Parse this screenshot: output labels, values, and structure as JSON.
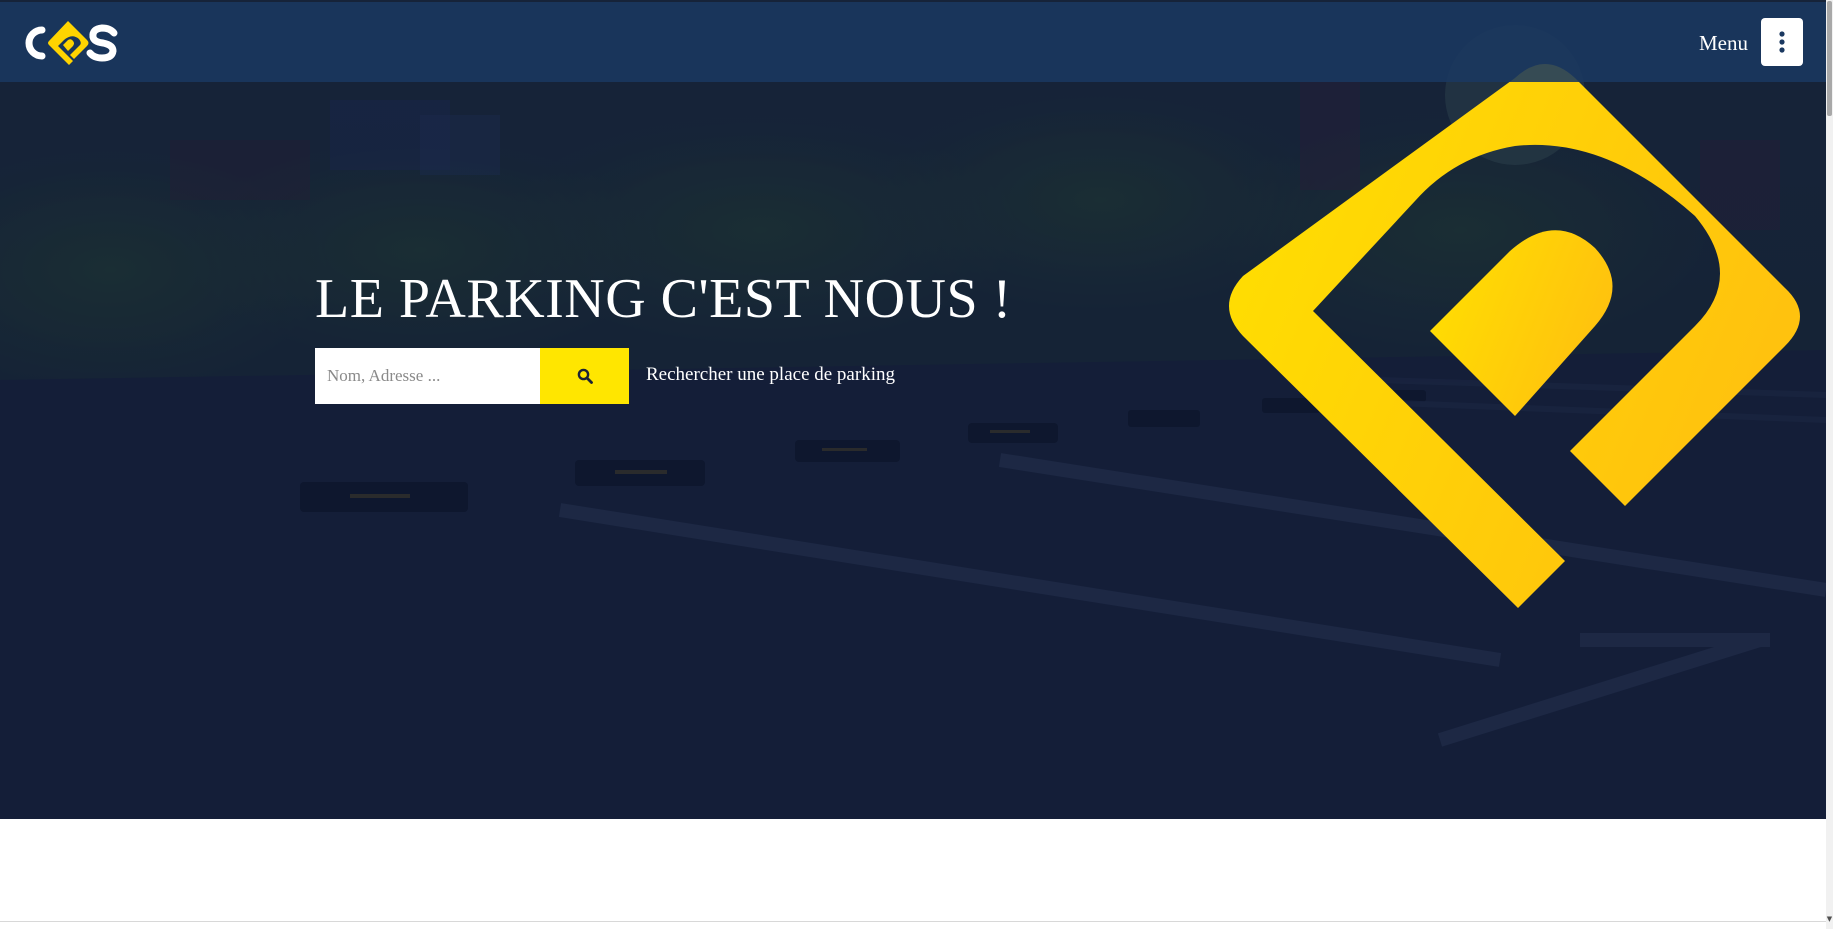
{
  "brand": {
    "logo_text": "COS",
    "colors": {
      "navy": "#1a3860",
      "yellow": "#ffd400",
      "hero_overlay": "#131d38"
    }
  },
  "header": {
    "menu_label": "Menu",
    "menu_icon": "vertical-ellipsis-icon"
  },
  "hero": {
    "title": "LE PARKING C'EST NOUS !",
    "search": {
      "placeholder": "Nom, Adresse ...",
      "value": "",
      "button_icon": "search-icon"
    },
    "caption": "Rechercher une place de parking"
  }
}
